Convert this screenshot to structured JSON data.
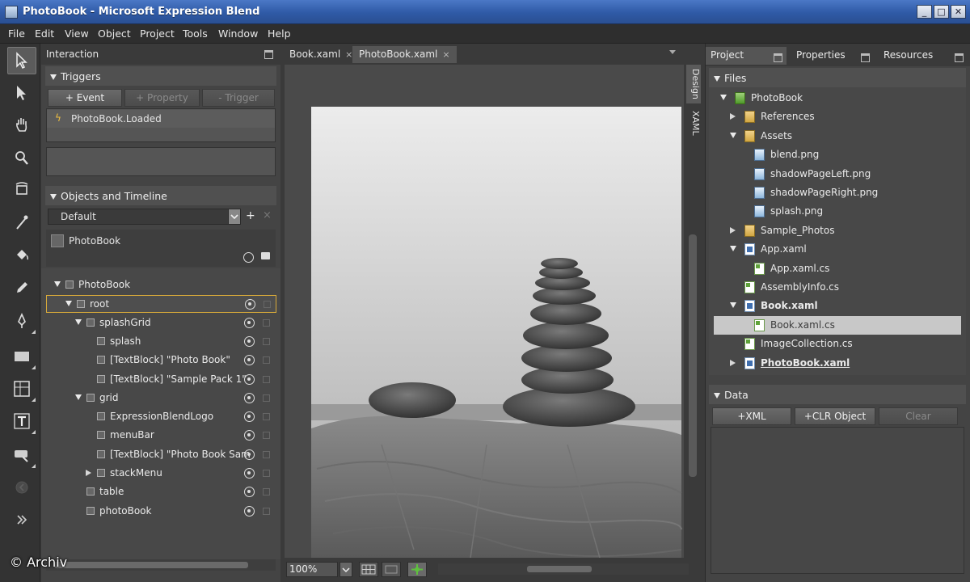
{
  "window": {
    "title": "PhotoBook - Microsoft Expression Blend",
    "controls": [
      "_",
      "□",
      "✕"
    ]
  },
  "menu": [
    "File",
    "Edit",
    "View",
    "Object",
    "Project",
    "Tools",
    "Window",
    "Help"
  ],
  "toolbox": {
    "tools": [
      "selection-arrow-icon",
      "direct-selection-icon",
      "pan-hand-icon",
      "zoom-icon",
      "camera-orbit-icon",
      "eyedropper-icon",
      "paint-bucket-icon",
      "pencil-icon",
      "pen-icon",
      "rectangle-icon",
      "grid-layout-icon",
      "text-icon",
      "asset-tool-icon",
      "disabled-tool-icon",
      "more-tools-icon"
    ]
  },
  "interaction": {
    "header": "Interaction",
    "triggers": {
      "title": "Triggers",
      "buttons": [
        "+ Event",
        "+ Property",
        "- Trigger"
      ],
      "items": [
        "PhotoBook.Loaded"
      ]
    },
    "objects": {
      "title": "Objects and Timeline",
      "timeline": "Default",
      "add_label": "+",
      "close_label": "×",
      "scope": "PhotoBook",
      "tree": [
        {
          "label": "PhotoBook",
          "indent": 0,
          "expander": "down",
          "eye": false
        },
        {
          "label": "root",
          "indent": 1,
          "expander": "down",
          "eye": true,
          "highlight": true
        },
        {
          "label": "splashGrid",
          "indent": 2,
          "expander": "down",
          "eye": true
        },
        {
          "label": "splash",
          "indent": 3,
          "expander": "",
          "eye": true
        },
        {
          "label": "[TextBlock] \"Photo Book\"",
          "indent": 3,
          "expander": "",
          "eye": true
        },
        {
          "label": "[TextBlock] \"Sample Pack 1\"",
          "indent": 3,
          "expander": "",
          "eye": true
        },
        {
          "label": "grid",
          "indent": 2,
          "expander": "down",
          "eye": true
        },
        {
          "label": "ExpressionBlendLogo",
          "indent": 3,
          "expander": "",
          "eye": true
        },
        {
          "label": "menuBar",
          "indent": 3,
          "expander": "",
          "eye": true
        },
        {
          "label": "[TextBlock] \"Photo Book Sam",
          "indent": 3,
          "expander": "",
          "eye": true
        },
        {
          "label": "stackMenu",
          "indent": 3,
          "expander": "right",
          "eye": true
        },
        {
          "label": "table",
          "indent": 2,
          "expander": "",
          "eye": true
        },
        {
          "label": "photoBook",
          "indent": 2,
          "expander": "",
          "eye": true
        }
      ]
    }
  },
  "document": {
    "tabs": [
      {
        "label": "Book.xaml",
        "close": "×",
        "active": false
      },
      {
        "label": "PhotoBook.xaml",
        "close": "×",
        "active": true
      }
    ],
    "view_tabs": [
      "Design",
      "XAML"
    ],
    "zoom": "100%"
  },
  "project": {
    "tabs": [
      "Project",
      "Properties",
      "Resources"
    ],
    "files_title": "Files",
    "files": [
      {
        "label": "PhotoBook",
        "indent": 0,
        "expander": "down",
        "icon": "proj"
      },
      {
        "label": "References",
        "indent": 1,
        "expander": "right",
        "icon": "folder"
      },
      {
        "label": "Assets",
        "indent": 1,
        "expander": "down",
        "icon": "folder"
      },
      {
        "label": "blend.png",
        "indent": 2,
        "expander": "",
        "icon": "img"
      },
      {
        "label": "shadowPageLeft.png",
        "indent": 2,
        "expander": "",
        "icon": "img"
      },
      {
        "label": "shadowPageRight.png",
        "indent": 2,
        "expander": "",
        "icon": "img"
      },
      {
        "label": "splash.png",
        "indent": 2,
        "expander": "",
        "icon": "img"
      },
      {
        "label": "Sample_Photos",
        "indent": 1,
        "expander": "right",
        "icon": "folder"
      },
      {
        "label": "App.xaml",
        "indent": 1,
        "expander": "down",
        "icon": "xaml"
      },
      {
        "label": "App.xaml.cs",
        "indent": 2,
        "expander": "",
        "icon": "cs"
      },
      {
        "label": "AssemblyInfo.cs",
        "indent": 1,
        "expander": "",
        "icon": "cs"
      },
      {
        "label": "Book.xaml",
        "indent": 1,
        "expander": "down",
        "icon": "xaml",
        "bold": true
      },
      {
        "label": "Book.xaml.cs",
        "indent": 2,
        "expander": "",
        "icon": "cs",
        "selected": true
      },
      {
        "label": "ImageCollection.cs",
        "indent": 1,
        "expander": "",
        "icon": "cs"
      },
      {
        "label": "PhotoBook.xaml",
        "indent": 1,
        "expander": "right",
        "icon": "xaml",
        "bold": true,
        "underline": true
      }
    ],
    "data_title": "Data",
    "data_buttons": [
      "+XML",
      "+CLR Object",
      "Clear"
    ]
  },
  "watermark": "© Archiv"
}
